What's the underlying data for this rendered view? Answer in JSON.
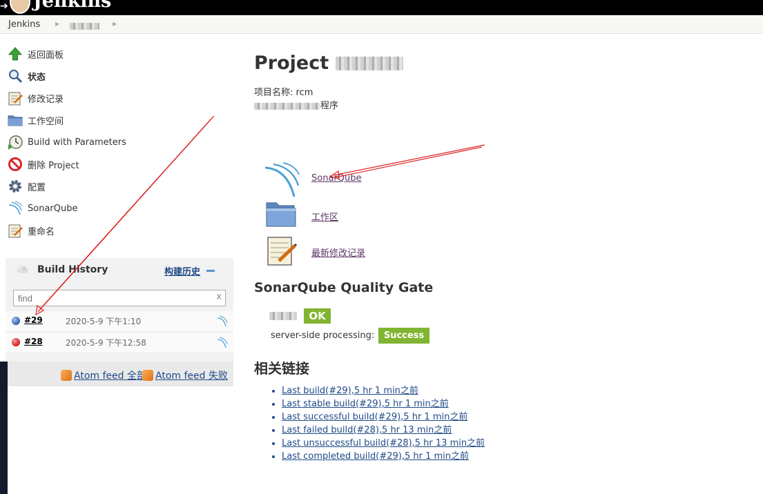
{
  "header": {
    "brand": "Jenkins"
  },
  "breadcrumbs": [
    "Jenkins"
  ],
  "sidebar": {
    "tasks": [
      {
        "label": "返回面板",
        "icon": "up-arrow-icon"
      },
      {
        "label": "状态",
        "icon": "search-icon"
      },
      {
        "label": "修改记录",
        "icon": "notepad-icon"
      },
      {
        "label": "工作空间",
        "icon": "folder-icon"
      },
      {
        "label": "Build with Parameters",
        "icon": "build-clock-icon"
      },
      {
        "label": "删除 Project",
        "icon": "no-entry-icon"
      },
      {
        "label": "配置",
        "icon": "gear-icon"
      },
      {
        "label": "SonarQube",
        "icon": "sonarqube-icon"
      },
      {
        "label": "重命名",
        "icon": "notepad-icon"
      }
    ]
  },
  "build_history": {
    "title": "Build History",
    "trend_label": "构建历史",
    "search_placeholder": "find",
    "search_clear": "x",
    "builds": [
      {
        "number": "#29",
        "date": "2020-5-9 下午1:10",
        "status_color": "#3a6fb5"
      },
      {
        "number": "#28",
        "date": "2020-5-9 下午12:58",
        "status_color": "#d9262a"
      }
    ],
    "feeds": [
      {
        "label": "Atom feed 全部"
      },
      {
        "label": "Atom feed 失败"
      }
    ]
  },
  "main": {
    "title": "Project",
    "project_name_line": "项目名称: rcm",
    "description_suffix": "程序",
    "actions": [
      {
        "label": "SonarQube",
        "icon": "sonarqube-icon"
      },
      {
        "label": "工作区",
        "icon": "folder-icon"
      },
      {
        "label": "最新修改记录",
        "icon": "notepad-icon"
      }
    ],
    "quality_gate": {
      "title": "SonarQube Quality Gate",
      "status": "OK",
      "processing_label": "server-side processing:",
      "processing_status": "Success"
    },
    "related_links": {
      "title": "相关链接",
      "items": [
        {
          "label": "Last build(#29),5 hr 1 min之前"
        },
        {
          "label": "Last stable build(#29),5 hr 1 min之前"
        },
        {
          "label": "Last successful build(#29),5 hr 1 min之前"
        },
        {
          "label": "Last failed build(#28),5 hr 13 min之前"
        },
        {
          "label": "Last unsuccessful build(#28),5 hr 13 min之前"
        },
        {
          "label": "Last completed build(#29),5 hr 1 min之前"
        }
      ]
    }
  },
  "colors": {
    "annotation_red": "#d22",
    "badge_green": "#80b432",
    "link_blue": "#204a87"
  }
}
